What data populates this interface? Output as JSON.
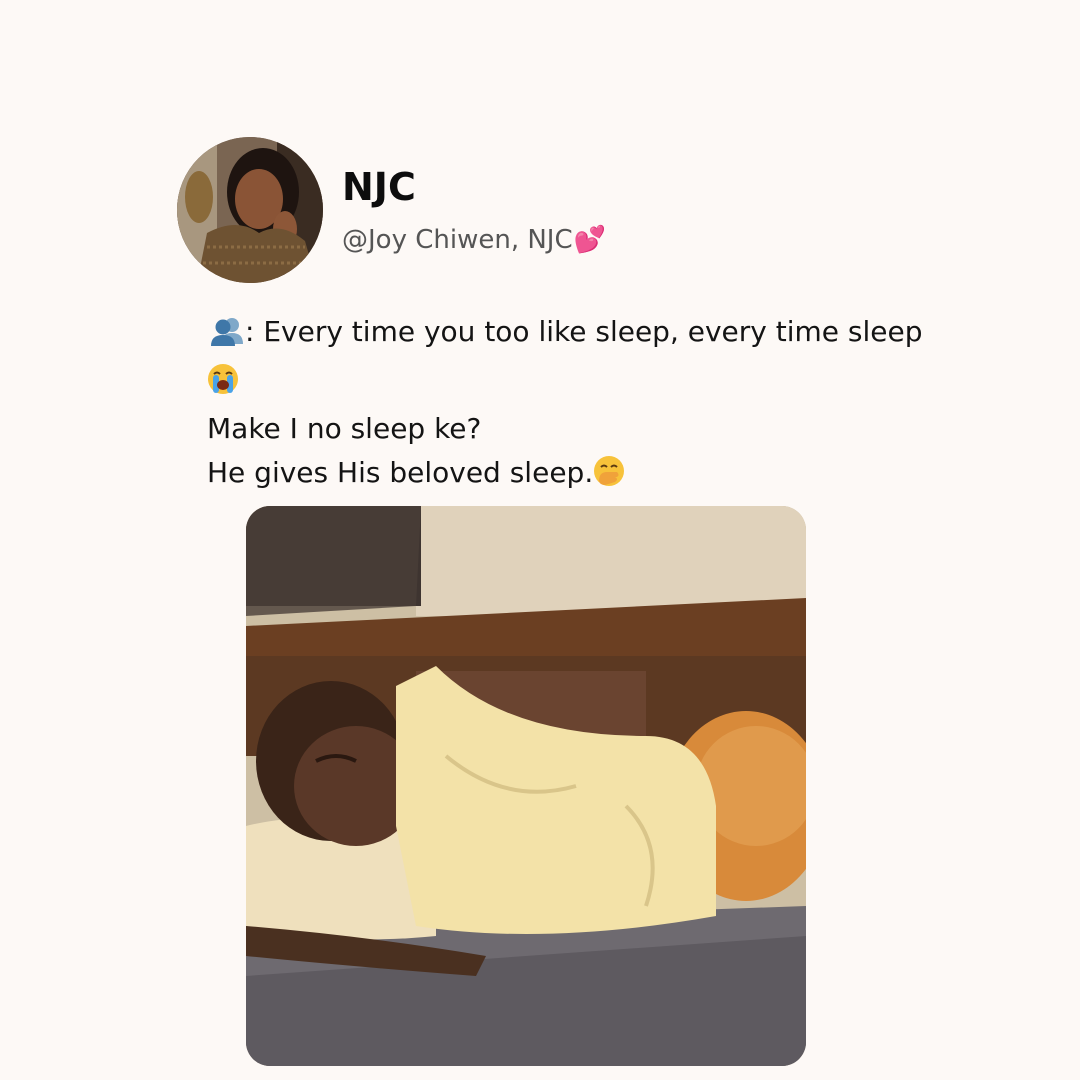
{
  "author": {
    "display_name": "NJC",
    "handle": "@Joy Chiwen, NJC",
    "handle_emoji": "💕"
  },
  "post": {
    "line1": ": Every time you too like sleep, every time sleep",
    "line1_emoji": "👥",
    "line2_emoji": "😭",
    "line3": "Make I no sleep ke?",
    "line4": "He gives His beloved sleep.",
    "line4_emoji": "🤭"
  },
  "colors": {
    "background": "#fdf9f6",
    "text": "#141414",
    "handle": "#555555",
    "heart": "#e0245e"
  }
}
